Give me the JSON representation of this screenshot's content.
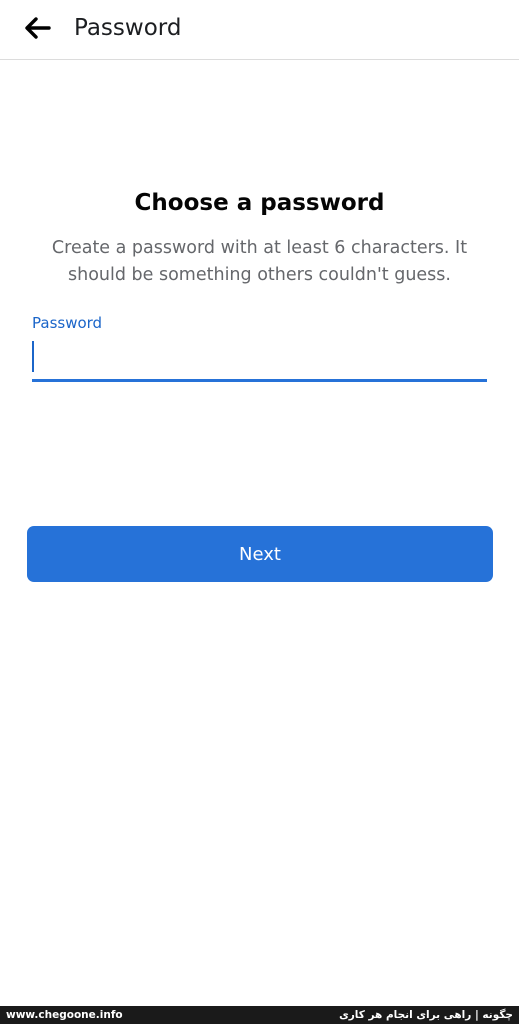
{
  "header": {
    "back_icon": "arrow-left-icon",
    "title": "Password"
  },
  "content": {
    "title": "Choose a password",
    "description": "Create a password with at least 6 characters. It should be something others couldn't guess."
  },
  "password_field": {
    "label": "Password",
    "value": ""
  },
  "next_button": {
    "label": "Next"
  },
  "footer": {
    "left_text": "www.chegoone.info",
    "right_text": "چگونه | راهی برای انجام هر کاری"
  },
  "colors": {
    "accent": "#2672d8",
    "label_blue": "#1b65c9",
    "text_primary": "#050505",
    "text_secondary": "#65676b"
  }
}
